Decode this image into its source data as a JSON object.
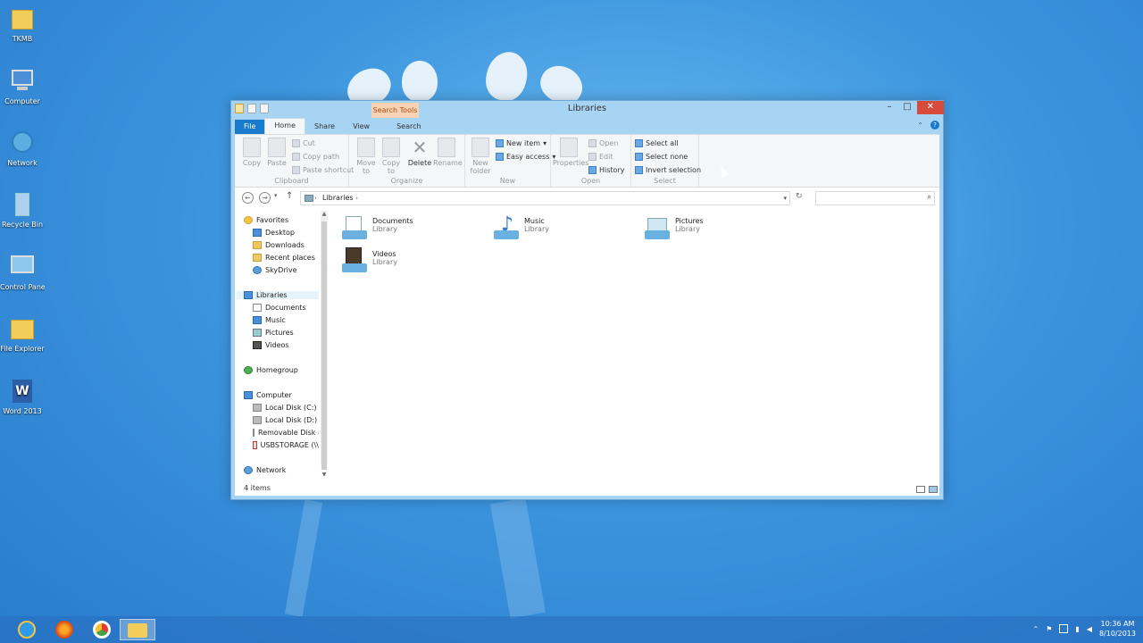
{
  "desktop": {
    "icons": [
      {
        "label": "TKMB",
        "icon": "folder-icon"
      },
      {
        "label": "Computer",
        "icon": "computer-icon"
      },
      {
        "label": "Network",
        "icon": "network-icon"
      },
      {
        "label": "Recycle Bin",
        "icon": "recycle-bin-icon"
      },
      {
        "label": "Control Panel",
        "icon": "control-panel-icon"
      },
      {
        "label": "File Explorer",
        "icon": "file-explorer-icon"
      },
      {
        "label": "Word 2013",
        "icon": "word-icon"
      }
    ]
  },
  "window": {
    "title": "Libraries",
    "context_tab": "Search Tools",
    "tabs": {
      "file": "File",
      "home": "Home",
      "share": "Share",
      "view": "View",
      "search": "Search"
    },
    "ribbon": {
      "clipboard": {
        "copy": "Copy",
        "paste": "Paste",
        "cut": "Cut",
        "copy_path": "Copy path",
        "paste_shortcut": "Paste shortcut",
        "group": "Clipboard"
      },
      "organize": {
        "move_to": "Move to",
        "copy_to": "Copy to",
        "delete": "Delete",
        "rename": "Rename",
        "group": "Organize"
      },
      "new": {
        "new_folder": "New folder",
        "new_item": "New item",
        "easy_access": "Easy access",
        "group": "New"
      },
      "open": {
        "properties": "Properties",
        "open": "Open",
        "edit": "Edit",
        "history": "History",
        "group": "Open"
      },
      "select": {
        "select_all": "Select all",
        "select_none": "Select none",
        "invert_selection": "Invert selection",
        "group": "Select"
      }
    },
    "address": {
      "path": "Libraries"
    },
    "navpane": {
      "favorites": "Favorites",
      "fav_items": [
        "Desktop",
        "Downloads",
        "Recent places",
        "SkyDrive"
      ],
      "libraries": "Libraries",
      "lib_items": [
        "Documents",
        "Music",
        "Pictures",
        "Videos"
      ],
      "homegroup": "Homegroup",
      "computer": "Computer",
      "comp_items": [
        "Local Disk (C:)",
        "Local Disk (D:)",
        "Removable Disk (",
        "USBSTORAGE (\\\\"
      ],
      "network": "Network"
    },
    "content": {
      "items": [
        {
          "name": "Documents",
          "type": "Library"
        },
        {
          "name": "Music",
          "type": "Library"
        },
        {
          "name": "Pictures",
          "type": "Library"
        },
        {
          "name": "Videos",
          "type": "Library"
        }
      ]
    },
    "status": "4 items"
  },
  "taskbar": {
    "time": "10:36 AM",
    "date": "8/10/2013"
  }
}
